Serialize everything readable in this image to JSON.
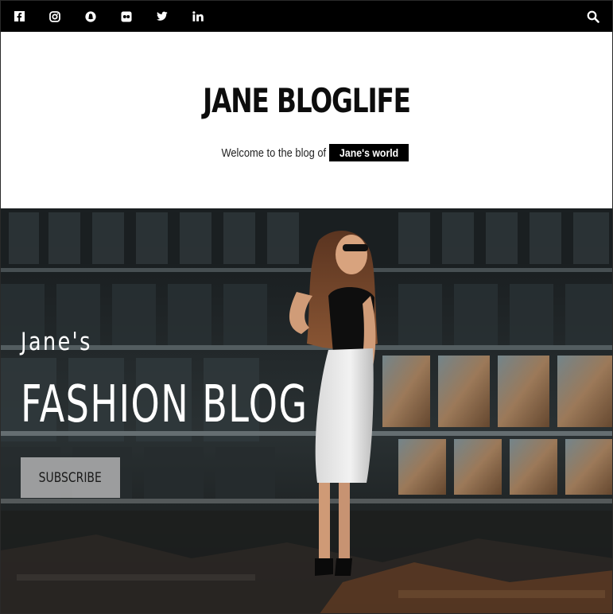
{
  "topbar": {
    "social_icons": [
      "facebook-icon",
      "instagram-icon",
      "snapchat-icon",
      "flickr-icon",
      "twitter-icon",
      "linkedin-icon"
    ],
    "search_icon": "search-icon",
    "background": "#000000"
  },
  "header": {
    "title": "JANE BLOGLIFE",
    "tagline": "Welcome to the blog of",
    "tagline_badge": "Jane's world"
  },
  "hero": {
    "subtitle": "Jane's",
    "title": "FASHION BLOG",
    "button_label": "SUBSCRIBE"
  }
}
